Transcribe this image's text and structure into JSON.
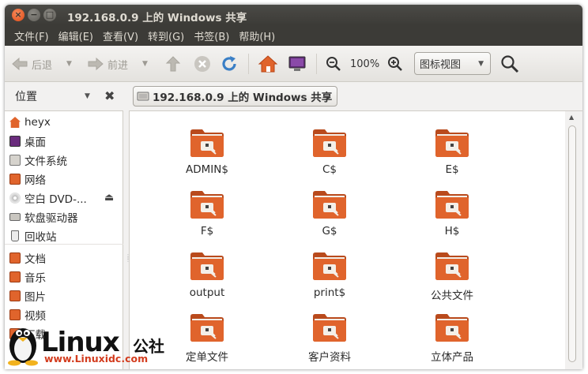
{
  "window": {
    "title": "192.168.0.9 上的 Windows 共享"
  },
  "menubar": {
    "items": [
      "文件(F)",
      "编辑(E)",
      "查看(V)",
      "转到(G)",
      "书签(B)",
      "帮助(H)"
    ]
  },
  "toolbar": {
    "back_label": "后退",
    "forward_label": "前进",
    "zoom_level": "100%",
    "view_mode": "图标视图"
  },
  "sidebar": {
    "header": "位置",
    "devices": [
      {
        "label": "heyx",
        "icon": "home-icon"
      },
      {
        "label": "桌面",
        "icon": "desktop-icon"
      },
      {
        "label": "文件系统",
        "icon": "filesystem-icon"
      },
      {
        "label": "网络",
        "icon": "network-icon"
      },
      {
        "label": "空白 DVD-...",
        "icon": "dvd-icon"
      },
      {
        "label": "软盘驱动器",
        "icon": "floppy-icon"
      },
      {
        "label": "回收站",
        "icon": "trash-icon"
      }
    ],
    "bookmarks": [
      {
        "label": "文档",
        "icon": "documents-icon"
      },
      {
        "label": "音乐",
        "icon": "music-icon"
      },
      {
        "label": "图片",
        "icon": "pictures-icon"
      },
      {
        "label": "视频",
        "icon": "videos-icon"
      },
      {
        "label": "下载",
        "icon": "downloads-icon"
      }
    ]
  },
  "location": {
    "path_button": "192.168.0.9 上的 Windows 共享"
  },
  "shares": [
    {
      "label": "ADMIN$"
    },
    {
      "label": "C$"
    },
    {
      "label": "E$"
    },
    {
      "label": "F$"
    },
    {
      "label": "G$"
    },
    {
      "label": "H$"
    },
    {
      "label": "output"
    },
    {
      "label": "print$"
    },
    {
      "label": "公共文件"
    },
    {
      "label": "定单文件"
    },
    {
      "label": "客户资料"
    },
    {
      "label": "立体产品"
    }
  ],
  "watermark": {
    "brand": "Linux",
    "brand_suffix": "公社",
    "url": "www.Linuxidc.com"
  },
  "colors": {
    "folder": "#e0642c",
    "accent_orange": "#dd4814",
    "titlebar": "#3c3b37"
  }
}
